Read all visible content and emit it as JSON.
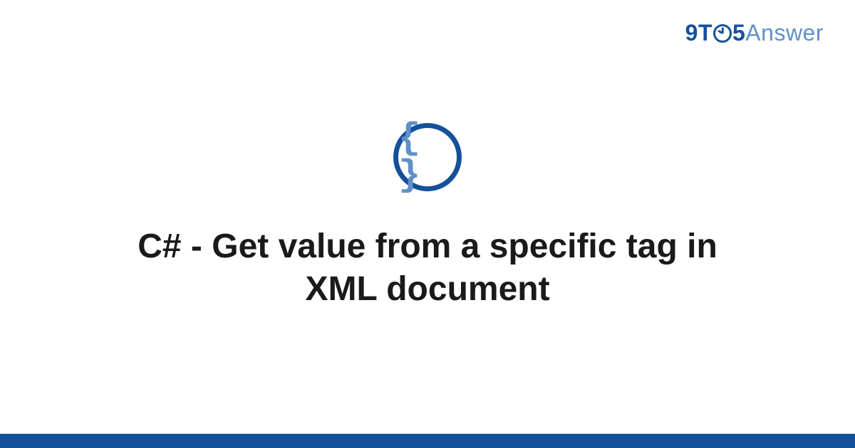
{
  "logo": {
    "part1": "9T",
    "part2": "5",
    "part3": "Answer"
  },
  "icon": {
    "name": "braces-icon",
    "glyph": "{ }"
  },
  "title": "C# - Get value from a specific tag in XML document",
  "colors": {
    "primary": "#14519a",
    "accent": "#5f91c9"
  }
}
